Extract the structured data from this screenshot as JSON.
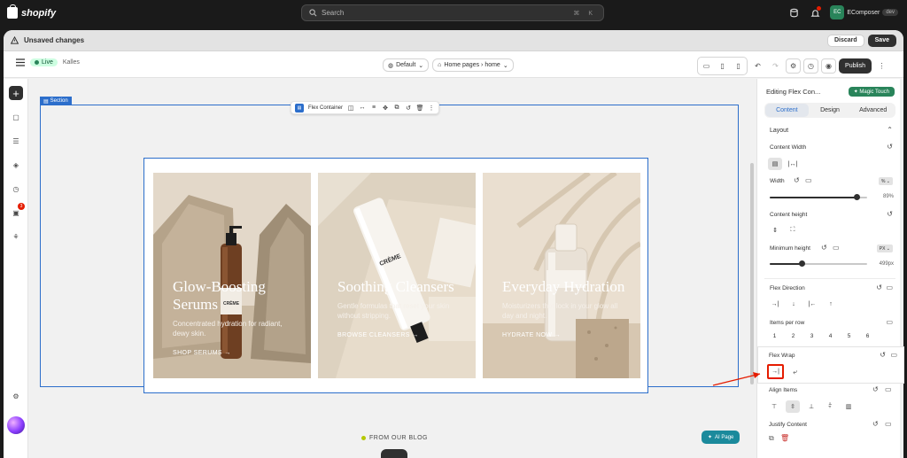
{
  "topbar": {
    "brand": "shopify",
    "search_placeholder": "Search",
    "search_shortcut": "⌘ K",
    "store_initials": "EC",
    "store_name": "EComposer",
    "store_tag": "dev"
  },
  "unsaved_bar": {
    "message": "Unsaved changes",
    "discard_label": "Discard",
    "save_label": "Save"
  },
  "toolbar": {
    "live_label": "Live",
    "theme_name": "Kalles",
    "template_label": "Default",
    "page_label": "Home pages › home",
    "publish_label": "Publish"
  },
  "canvas": {
    "section_tag": "Section",
    "flex_toolbar_label": "Flex Container",
    "cards": [
      {
        "heading": "Glow-Boosting Serums",
        "subtext": "Concentrated hydration for radiant, dewy skin.",
        "link": "SHOP SERUMS →"
      },
      {
        "heading": "Soothing Cleansers",
        "subtext": "Gentle formulas that reset your skin without stripping.",
        "link": "BROWSE CLEANSERS →"
      },
      {
        "heading": "Everyday Hydration",
        "subtext": "Moisturizers that lock in your glow all day and night.",
        "link": "HYDRATE NOW →"
      }
    ],
    "blog_label": "FROM OUR BLOG",
    "ai_page_label": "AI Page",
    "product_label": "CRÈME"
  },
  "panel": {
    "title": "Editing Flex Con...",
    "magic_label": "Magic Touch",
    "tabs": [
      "Content",
      "Design",
      "Advanced"
    ],
    "layout_label": "Layout",
    "content_width_label": "Content Width",
    "width_label": "Width",
    "width_unit": "%",
    "width_value": "89%",
    "width_fraction": 0.89,
    "content_height_label": "Content height",
    "min_height_label": "Minimum height",
    "min_height_unit": "PX",
    "min_height_value": "499px",
    "min_height_fraction": 0.33,
    "flex_direction_label": "Flex Direction",
    "items_per_row_label": "Items per row",
    "items_per_row": [
      "1",
      "2",
      "3",
      "4",
      "5",
      "6"
    ],
    "flex_wrap_label": "Flex Wrap",
    "align_items_label": "Align Items",
    "justify_content_label": "Justify Content"
  },
  "colors": {
    "accent_blue": "#2c6ecb",
    "annotation_red": "#e51c00",
    "magic_green": "#29845a"
  }
}
